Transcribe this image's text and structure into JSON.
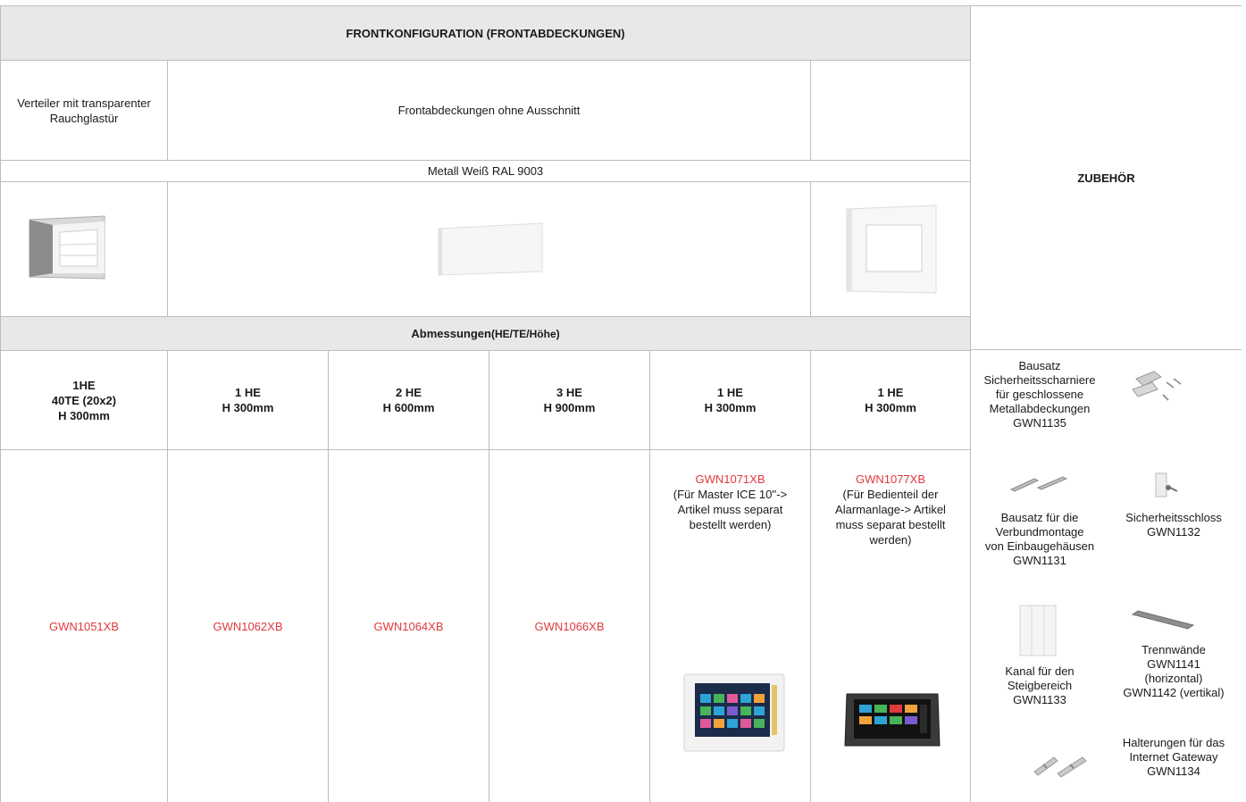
{
  "header": {
    "title": "FRONTKONFIGURATION (FRONTABDECKUNGEN)",
    "accessories_title": "ZUBEHÖR"
  },
  "types": {
    "col1_line1": "Verteiler mit transparenter",
    "col1_line2": "Rauchglastür",
    "col2": "Frontabdeckungen ohne Ausschnitt",
    "col3": ""
  },
  "material": "Metall Weiß RAL 9003",
  "dimensions": {
    "label_bold": "Abmessungen",
    "label_rest": " (HE/TE/Höhe)"
  },
  "sizes": [
    {
      "l1": "1HE",
      "l2": "40TE (20x2)",
      "l3": "H 300mm"
    },
    {
      "l1": "1 HE",
      "l2": "H 300mm",
      "l3": ""
    },
    {
      "l1": "2 HE",
      "l2": "H 600mm",
      "l3": ""
    },
    {
      "l1": "3 HE",
      "l2": "H 900mm",
      "l3": ""
    },
    {
      "l1": "1 HE",
      "l2": "H 300mm",
      "l3": ""
    },
    {
      "l1": "1 HE",
      "l2": "H 300mm",
      "l3": ""
    }
  ],
  "codes": [
    "GWN1051XB",
    "GWN1062XB",
    "GWN1064XB",
    "GWN1066XB"
  ],
  "special": [
    {
      "code": "GWN1071XB",
      "lines": [
        "(Für Master ICE 10''->",
        "Artikel muss separat",
        "bestellt werden)"
      ]
    },
    {
      "code": "GWN1077XB",
      "lines": [
        "(Für Bedienteil der",
        "Alarmanlage-> Artikel",
        "muss separat bestellt",
        "werden)"
      ]
    }
  ],
  "accessories": [
    {
      "lines": [
        "Bausatz",
        "Sicherheitsscharniere",
        "für geschlossene",
        "Metallabdeckungen",
        "GWN1135"
      ],
      "icon": "hinge-kit-icon"
    },
    {
      "lines": [
        "Bausatz für die",
        "Verbundmontage",
        "von Einbaugehäusen",
        "GWN1131"
      ],
      "icon": "rail-kit-icon"
    },
    {
      "lines": [
        "Sicherheitsschloss",
        "GWN1132"
      ],
      "icon": "lock-icon"
    },
    {
      "lines": [
        "Kanal für den",
        "Steigbereich",
        "GWN1133"
      ],
      "icon": "channel-icon"
    },
    {
      "lines": [
        "Trennwände",
        "GWN1141",
        "(horizontal)",
        "GWN1142 (vertikal)"
      ],
      "icon": "divider-icon"
    },
    {
      "lines": [
        "Halterungen für das",
        "Internet Gateway",
        "GWN1134"
      ],
      "icon": "bracket-icon"
    }
  ]
}
